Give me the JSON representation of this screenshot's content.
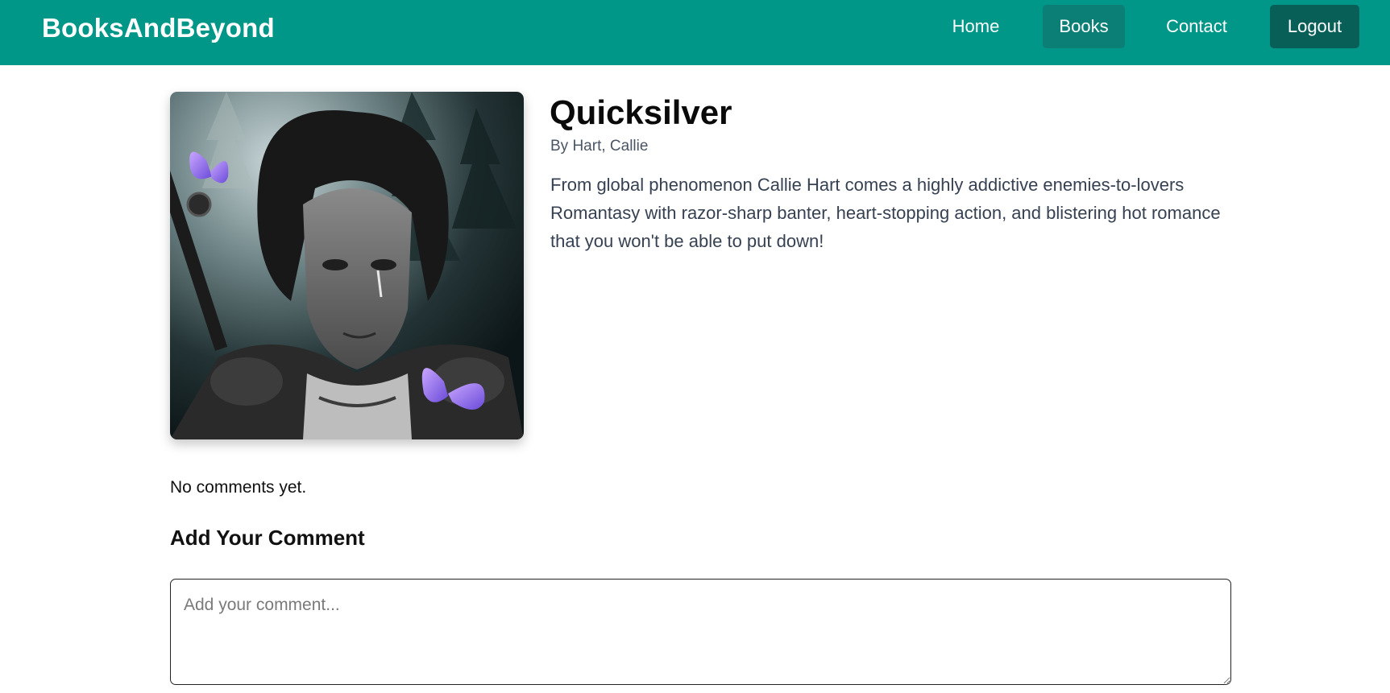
{
  "app": {
    "brand": "BooksAndBeyond"
  },
  "nav": {
    "home": "Home",
    "books": "Books",
    "contact": "Contact",
    "logout": "Logout"
  },
  "book": {
    "title": "Quicksilver",
    "author": "By Hart, Callie",
    "description": "From global phenomenon Callie Hart comes a highly addictive enemies-to-lovers Romantasy with razor-sharp banter, heart-stopping action, and blistering hot romance that you won't be able to put down!"
  },
  "comments": {
    "empty_text": "No comments yet.",
    "add_heading": "Add Your Comment",
    "placeholder": "Add your comment...",
    "value": ""
  },
  "colors": {
    "nav_bg": "#009688",
    "nav_active": "#0b7f75",
    "logout_bg": "#075f58"
  }
}
